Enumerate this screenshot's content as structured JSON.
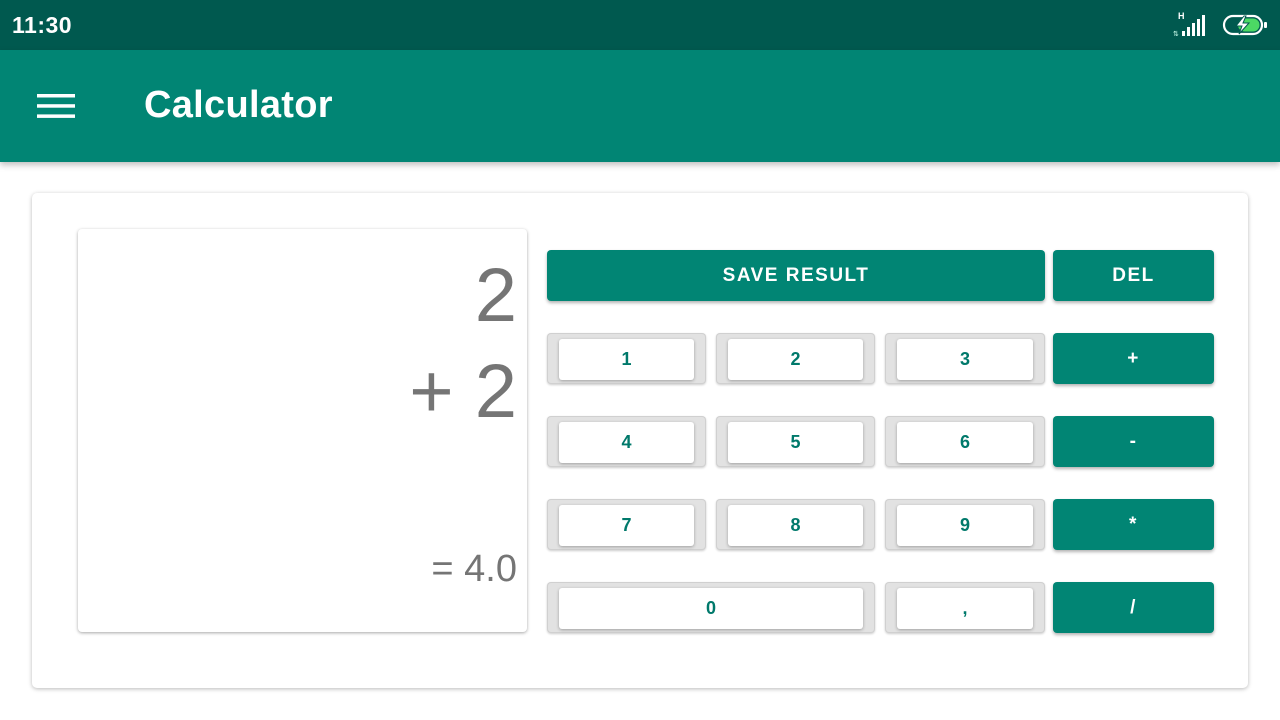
{
  "status_bar": {
    "time": "11:30",
    "network_type": "H",
    "icons": [
      "signal-icon",
      "battery-charging-icon"
    ]
  },
  "app_bar": {
    "title": "Calculator",
    "menu_icon": "hamburger-menu-icon"
  },
  "display": {
    "line1": "2",
    "line2": "+ 2",
    "result": "= 4.0"
  },
  "actions": {
    "save_label": "SAVE RESULT",
    "delete_label": "DEL"
  },
  "keypad": {
    "digits": [
      "1",
      "2",
      "3",
      "4",
      "5",
      "6",
      "7",
      "8",
      "9",
      "0",
      ","
    ],
    "operators": [
      "+",
      "-",
      "*",
      "/"
    ]
  },
  "colors": {
    "primary": "#018574",
    "primary_dark": "#00594f",
    "digit_text": "#00796b",
    "display_text": "#757575"
  }
}
